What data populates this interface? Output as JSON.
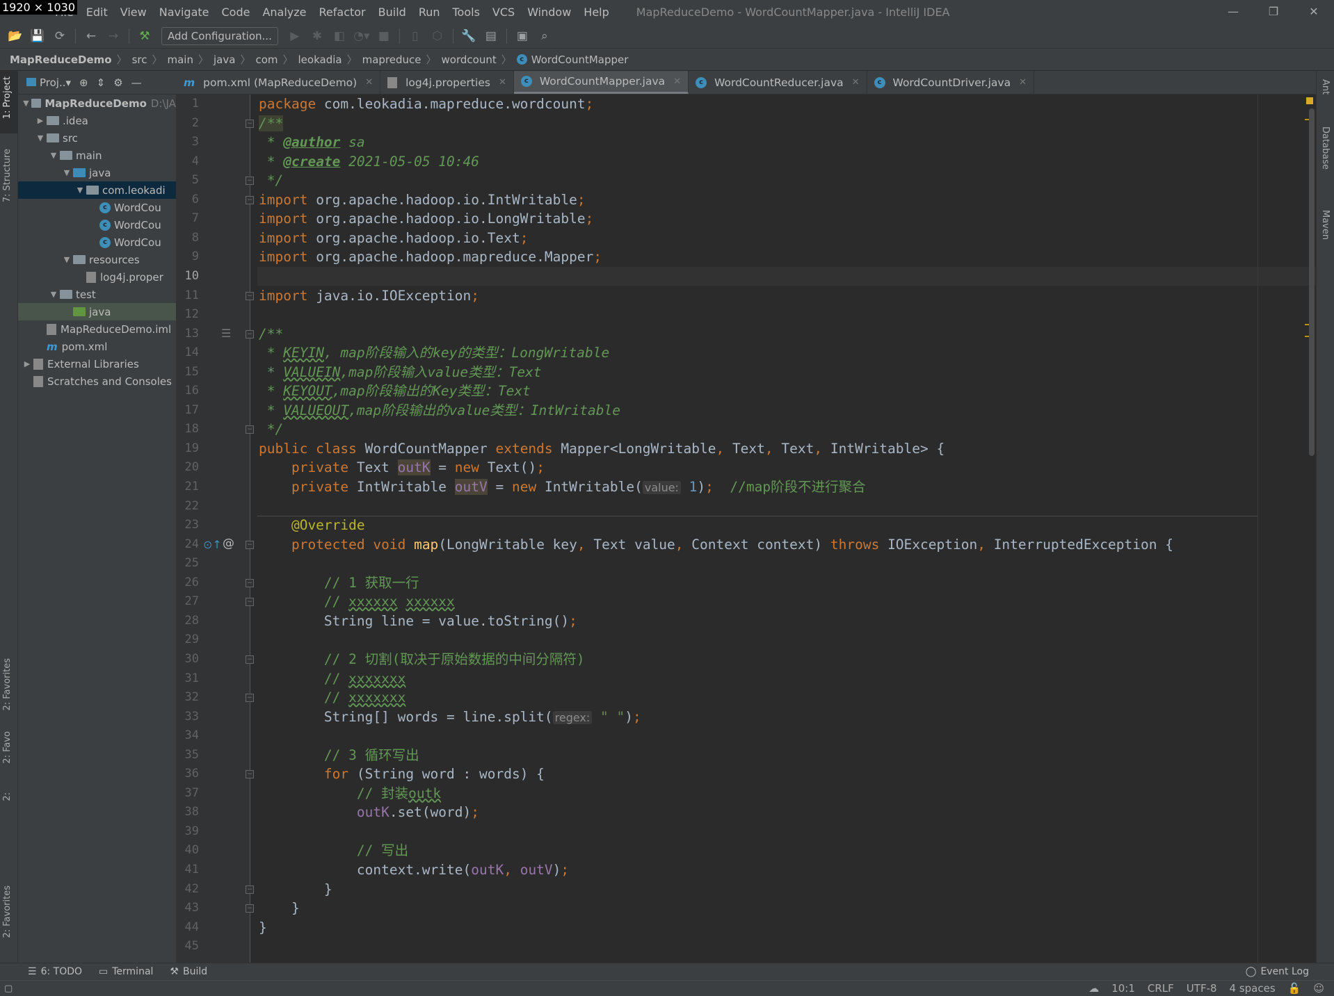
{
  "overlay": "1920 × 1030",
  "window": {
    "title": "MapReduceDemo - WordCountMapper.java - IntelliJ IDEA",
    "controls": [
      "minimize",
      "restore",
      "close"
    ]
  },
  "menu": [
    "File",
    "Edit",
    "View",
    "Navigate",
    "Code",
    "Analyze",
    "Refactor",
    "Build",
    "Run",
    "Tools",
    "VCS",
    "Window",
    "Help"
  ],
  "toolbar": {
    "add_configuration": "Add Configuration..."
  },
  "breadcrumb": [
    "MapReduceDemo",
    "src",
    "main",
    "java",
    "com",
    "leokadia",
    "mapreduce",
    "wordcount",
    "WordCountMapper"
  ],
  "left_stripe": {
    "project": "1: Project",
    "structure": "7: Structure",
    "favorites": "2: Favorites",
    "favorites2": "2: Favo",
    "favorites3": "2:",
    "favorites4": "2: Favorites"
  },
  "right_stripe": [
    "Ant",
    "Database",
    "Maven"
  ],
  "project_panel": {
    "view": "Proj..",
    "tree": [
      {
        "label": "MapReduceDemo",
        "path": "D:\\JA",
        "depth": 0,
        "icon": "module-folder",
        "expanded": true,
        "bold": true
      },
      {
        "label": ".idea",
        "depth": 1,
        "icon": "folder",
        "expanded": false
      },
      {
        "label": "src",
        "depth": 1,
        "icon": "folder",
        "expanded": true
      },
      {
        "label": "main",
        "depth": 2,
        "icon": "folder",
        "expanded": true
      },
      {
        "label": "java",
        "depth": 3,
        "icon": "source-folder",
        "expanded": true
      },
      {
        "label": "com.leokadi",
        "depth": 4,
        "icon": "package",
        "expanded": true,
        "selected": true
      },
      {
        "label": "WordCou",
        "depth": 5,
        "icon": "java-class"
      },
      {
        "label": "WordCou",
        "depth": 5,
        "icon": "java-class"
      },
      {
        "label": "WordCou",
        "depth": 5,
        "icon": "java-class"
      },
      {
        "label": "resources",
        "depth": 3,
        "icon": "resources-folder",
        "expanded": true
      },
      {
        "label": "log4j.proper",
        "depth": 4,
        "icon": "properties-file"
      },
      {
        "label": "test",
        "depth": 2,
        "icon": "folder",
        "expanded": true
      },
      {
        "label": "java",
        "depth": 3,
        "icon": "test-folder",
        "highlighted": true
      },
      {
        "label": "MapReduceDemo.iml",
        "depth": 1,
        "icon": "iml-file"
      },
      {
        "label": "pom.xml",
        "depth": 1,
        "icon": "maven"
      },
      {
        "label": "External Libraries",
        "depth": 0,
        "icon": "libraries",
        "expanded": false
      },
      {
        "label": "Scratches and Consoles",
        "depth": 0,
        "icon": "scratches"
      }
    ]
  },
  "tabs": [
    {
      "label": "pom.xml (MapReduceDemo)",
      "icon": "maven"
    },
    {
      "label": "log4j.properties",
      "icon": "properties-file"
    },
    {
      "label": "WordCountMapper.java",
      "icon": "java-class",
      "active": true
    },
    {
      "label": "WordCountReducer.java",
      "icon": "java-class"
    },
    {
      "label": "WordCountDriver.java",
      "icon": "java-class"
    }
  ],
  "editor": {
    "current_line": 10,
    "lines": [
      [
        [
          "k",
          "package "
        ],
        [
          "p",
          "com.leokadia.mapreduce.wordcount"
        ],
        [
          "pu",
          ";"
        ]
      ],
      [
        [
          "d",
          "/**"
        ]
      ],
      [
        [
          "d",
          " * "
        ],
        [
          "t",
          "@author"
        ],
        [
          "d",
          " sa"
        ]
      ],
      [
        [
          "d",
          " * "
        ],
        [
          "t",
          "@create"
        ],
        [
          "d",
          " 2021-05-05 10:46"
        ]
      ],
      [
        [
          "d",
          " */"
        ]
      ],
      [
        [
          "k",
          "import "
        ],
        [
          "p",
          "org.apache.hadoop.io.IntWritable"
        ],
        [
          "pu",
          ";"
        ]
      ],
      [
        [
          "k",
          "import "
        ],
        [
          "p",
          "org.apache.hadoop.io.LongWritable"
        ],
        [
          "pu",
          ";"
        ]
      ],
      [
        [
          "k",
          "import "
        ],
        [
          "p",
          "org.apache.hadoop.io.Text"
        ],
        [
          "pu",
          ";"
        ]
      ],
      [
        [
          "k",
          "import "
        ],
        [
          "p",
          "org.apache.hadoop.mapreduce.Mapper"
        ],
        [
          "pu",
          ";"
        ]
      ],
      [],
      [
        [
          "k",
          "import "
        ],
        [
          "p",
          "java.io.IOException"
        ],
        [
          "pu",
          ";"
        ]
      ],
      [],
      [
        [
          "d",
          "/**"
        ]
      ],
      [
        [
          "d",
          " * "
        ],
        [
          "dw",
          "KEYIN"
        ],
        [
          "d",
          ", map阶段输入的key的类型：LongWritable"
        ]
      ],
      [
        [
          "d",
          " * "
        ],
        [
          "dw",
          "VALUEIN"
        ],
        [
          "d",
          ",map阶段输入value类型：Text"
        ]
      ],
      [
        [
          "d",
          " * "
        ],
        [
          "dw",
          "KEYOUT"
        ],
        [
          "d",
          ",map阶段输出的Key类型：Text"
        ]
      ],
      [
        [
          "d",
          " * "
        ],
        [
          "dw",
          "VALUEOUT"
        ],
        [
          "d",
          ",map阶段输出的value类型：IntWritable"
        ]
      ],
      [
        [
          "d",
          " */"
        ]
      ],
      [
        [
          "k",
          "public class "
        ],
        [
          "p",
          "WordCountMapper "
        ],
        [
          "k",
          "extends "
        ],
        [
          "p",
          "Mapper<LongWritable"
        ],
        [
          "pu",
          ", "
        ],
        [
          "p",
          "Text"
        ],
        [
          "pu",
          ", "
        ],
        [
          "p",
          "Text"
        ],
        [
          "pu",
          ", "
        ],
        [
          "p",
          "IntWritable> {"
        ]
      ],
      [
        [
          "p",
          "    "
        ],
        [
          "k",
          "private "
        ],
        [
          "p",
          "Text "
        ],
        [
          "fb",
          "outK"
        ],
        [
          "p",
          " = "
        ],
        [
          "k",
          "new "
        ],
        [
          "p",
          "Text()"
        ],
        [
          "pu",
          ";"
        ]
      ],
      [
        [
          "p",
          "    "
        ],
        [
          "k",
          "private "
        ],
        [
          "p",
          "IntWritable "
        ],
        [
          "fb",
          "outV"
        ],
        [
          "p",
          " = "
        ],
        [
          "k",
          "new "
        ],
        [
          "p",
          "IntWritable("
        ],
        [
          "h",
          "value:"
        ],
        [
          "n",
          " 1"
        ],
        [
          "p",
          ")"
        ],
        [
          "pu",
          ";"
        ],
        [
          "c",
          "  //map阶段不进行聚合"
        ]
      ],
      [],
      [
        [
          "a",
          "    @Override"
        ]
      ],
      [
        [
          "p",
          "    "
        ],
        [
          "k",
          "protected void "
        ],
        [
          "m",
          "map"
        ],
        [
          "p",
          "(LongWritable key"
        ],
        [
          "pu",
          ", "
        ],
        [
          "p",
          "Text value"
        ],
        [
          "pu",
          ", "
        ],
        [
          "p",
          "Context context) "
        ],
        [
          "k",
          "throws "
        ],
        [
          "p",
          "IOException"
        ],
        [
          "pu",
          ", "
        ],
        [
          "p",
          "InterruptedException {"
        ]
      ],
      [],
      [
        [
          "c",
          "        // 1 获取一行"
        ]
      ],
      [
        [
          "c",
          "        // "
        ],
        [
          "cw",
          "xxxxxx"
        ],
        [
          "c",
          " "
        ],
        [
          "cw",
          "xxxxxx"
        ]
      ],
      [
        [
          "p",
          "        String line = value.toString()"
        ],
        [
          "pu",
          ";"
        ]
      ],
      [],
      [
        [
          "c",
          "        // 2 切割(取决于原始数据的中间分隔符)"
        ]
      ],
      [
        [
          "c",
          "        // "
        ],
        [
          "cw",
          "xxxxxxx"
        ]
      ],
      [
        [
          "c",
          "        // "
        ],
        [
          "cw",
          "xxxxxxx"
        ]
      ],
      [
        [
          "p",
          "        String[] words = line.split("
        ],
        [
          "h",
          "regex:"
        ],
        [
          "s",
          " \" \""
        ],
        [
          "p",
          ")"
        ],
        [
          "pu",
          ";"
        ]
      ],
      [],
      [
        [
          "c",
          "        // 3 循环写出"
        ]
      ],
      [
        [
          "p",
          "        "
        ],
        [
          "k",
          "for "
        ],
        [
          "p",
          "(String word : words) {"
        ]
      ],
      [
        [
          "c",
          "            // 封装"
        ],
        [
          "cw",
          "outk"
        ]
      ],
      [
        [
          "p",
          "            "
        ],
        [
          "f",
          "outK"
        ],
        [
          "p",
          ".set(word)"
        ],
        [
          "pu",
          ";"
        ]
      ],
      [],
      [
        [
          "c",
          "            // 写出"
        ]
      ],
      [
        [
          "p",
          "            context.write("
        ],
        [
          "f",
          "outK"
        ],
        [
          "pu",
          ", "
        ],
        [
          "f",
          "outV"
        ],
        [
          "p",
          ")"
        ],
        [
          "pu",
          ";"
        ]
      ],
      [
        [
          "p",
          "        }"
        ]
      ],
      [
        [
          "p",
          "    }"
        ]
      ],
      [
        [
          "p",
          "}"
        ]
      ],
      []
    ]
  },
  "bottom_bar": {
    "todo": "6: TODO",
    "terminal": "Terminal",
    "build": "Build",
    "event_log": "Event Log"
  },
  "status": {
    "position": "10:1",
    "line_separator": "CRLF",
    "encoding": "UTF-8",
    "indent": "4 spaces"
  },
  "colors": {
    "keyword": "#cc7832",
    "comment": "#629755",
    "field": "#9876aa",
    "annotation": "#bbb529",
    "method": "#ffc66d",
    "number": "#6897bb",
    "string": "#6a8759",
    "selection": "#0d293e"
  }
}
